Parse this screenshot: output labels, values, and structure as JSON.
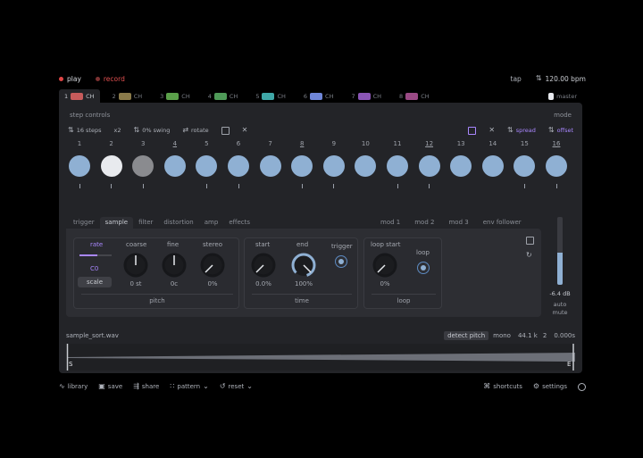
{
  "topbar": {
    "play_label": "play",
    "record_label": "record",
    "tap_label": "tap",
    "tempo": "120.00 bpm",
    "play_color": "#e04545",
    "record_color": "#e04545"
  },
  "tabs": [
    {
      "num": "1",
      "label": "CH",
      "color": "#c65b5b"
    },
    {
      "num": "2",
      "label": "CH",
      "color": "#8a7a4a"
    },
    {
      "num": "3",
      "label": "CH",
      "color": "#5ba04a"
    },
    {
      "num": "4",
      "label": "CH",
      "color": "#4f9a58"
    },
    {
      "num": "5",
      "label": "CH",
      "color": "#3fa7a7"
    },
    {
      "num": "6",
      "label": "CH",
      "color": "#6f86d8"
    },
    {
      "num": "7",
      "label": "CH",
      "color": "#8a55b5"
    },
    {
      "num": "8",
      "label": "CH",
      "color": "#9a4a85"
    }
  ],
  "tabs_right": "master",
  "panel": {
    "step_controls_label": "step controls",
    "mode_label": "mode",
    "controls": {
      "steps": "16 steps",
      "x2": "x2",
      "swing": "0% swing",
      "rotate": "rotate",
      "spread": "spread",
      "offset": "offset"
    },
    "steps": [
      {
        "num": "1",
        "state": "on",
        "underline": false,
        "mark": true
      },
      {
        "num": "2",
        "state": "white",
        "underline": false,
        "mark": true
      },
      {
        "num": "3",
        "state": "grey",
        "underline": false,
        "mark": true
      },
      {
        "num": "4",
        "state": "on",
        "underline": true,
        "mark": false
      },
      {
        "num": "5",
        "state": "on",
        "underline": false,
        "mark": true
      },
      {
        "num": "6",
        "state": "on",
        "underline": false,
        "mark": true
      },
      {
        "num": "7",
        "state": "on",
        "underline": false,
        "mark": false
      },
      {
        "num": "8",
        "state": "on",
        "underline": true,
        "mark": true
      },
      {
        "num": "9",
        "state": "on",
        "underline": false,
        "mark": true
      },
      {
        "num": "10",
        "state": "on",
        "underline": false,
        "mark": false
      },
      {
        "num": "11",
        "state": "on",
        "underline": false,
        "mark": true
      },
      {
        "num": "12",
        "state": "on",
        "underline": true,
        "mark": true
      },
      {
        "num": "13",
        "state": "on",
        "underline": false,
        "mark": false
      },
      {
        "num": "14",
        "state": "on",
        "underline": false,
        "mark": false
      },
      {
        "num": "15",
        "state": "on",
        "underline": false,
        "mark": true
      },
      {
        "num": "16",
        "state": "on",
        "underline": true,
        "mark": true
      }
    ],
    "sub_tabs": [
      "trigger",
      "sample",
      "filter",
      "distortion",
      "amp",
      "effects"
    ],
    "active_sub_tab": "sample",
    "mods": [
      "mod 1",
      "mod 2",
      "mod 3",
      "env follower"
    ],
    "pitch_group": {
      "rate_label": "rate",
      "rate_value": "C0",
      "scale_label": "scale",
      "coarse_label": "coarse",
      "coarse_value": "0 st",
      "fine_label": "fine",
      "fine_value": "0c",
      "stereo_label": "stereo",
      "stereo_value": "0%",
      "title": "pitch"
    },
    "time_group": {
      "start_label": "start",
      "start_value": "0.0%",
      "end_label": "end",
      "end_value": "100%",
      "trigger_label": "trigger",
      "title": "time"
    },
    "loop_group": {
      "loop_start_label": "loop start",
      "loop_start_value": "0%",
      "loop_label": "loop",
      "title": "loop"
    },
    "meter": {
      "level_db": "-6.4 dB",
      "auto_label": "auto",
      "mute_label": "mute",
      "fill_fraction": 0.48
    },
    "waveform": {
      "filename": "sample_sort.wav",
      "detect_pitch": "detect pitch",
      "channels": "mono",
      "sample_rate": "44.1 k",
      "bits": "2",
      "duration": "0.000s",
      "start_marker": "S",
      "end_marker": "E"
    }
  },
  "bottombar": {
    "library": "library",
    "save": "save",
    "share": "share",
    "pattern": "pattern",
    "reset": "reset",
    "shortcuts": "shortcuts",
    "settings": "settings"
  },
  "colors": {
    "accent_blue": "#8fb0d3",
    "accent_purple": "#a987ff",
    "panel_bg": "#232428"
  }
}
